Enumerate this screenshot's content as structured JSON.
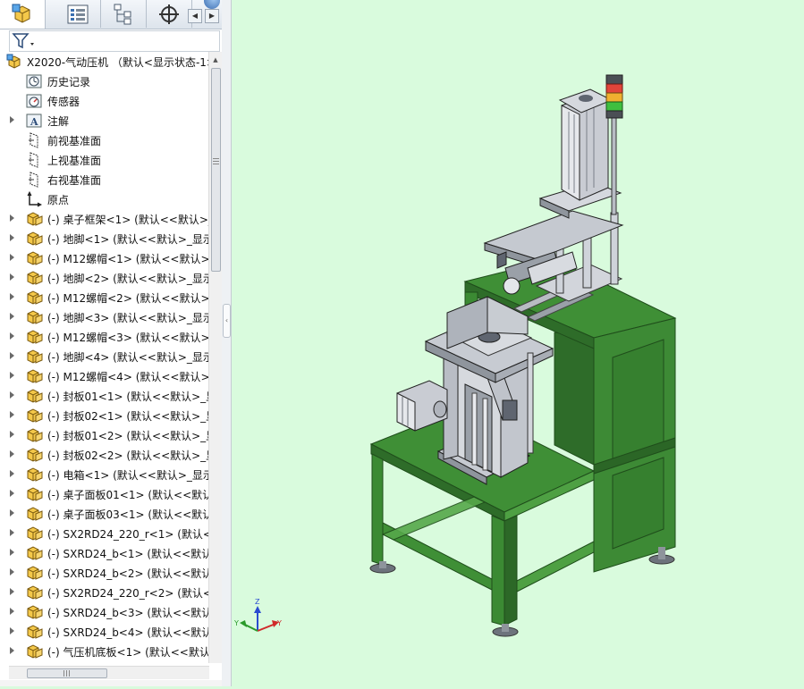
{
  "tabs": [
    {
      "name": "feature-manager",
      "icon": "assembly-icon",
      "active": true
    },
    {
      "name": "property-manager",
      "icon": "property-list-icon"
    },
    {
      "name": "configuration-manager",
      "icon": "configuration-tree-icon"
    },
    {
      "name": "dimxpert-manager",
      "icon": "crosshair-icon"
    }
  ],
  "tree": {
    "root_label": "X2020-气动压机 （默认<显示状态-1>",
    "items": [
      {
        "label": "历史记录",
        "icon": "history-icon",
        "expandable": false
      },
      {
        "label": "传感器",
        "icon": "sensor-icon",
        "expandable": false
      },
      {
        "label": "注解",
        "icon": "annotation-icon",
        "expandable": true
      },
      {
        "label": "前视基准面",
        "icon": "plane-icon",
        "expandable": false
      },
      {
        "label": "上视基准面",
        "icon": "plane-icon",
        "expandable": false
      },
      {
        "label": "右视基准面",
        "icon": "plane-icon",
        "expandable": false
      },
      {
        "label": "原点",
        "icon": "origin-icon",
        "expandable": false
      },
      {
        "label": "(-) 桌子框架<1> (默认<<默认>_",
        "icon": "part-icon",
        "expandable": true
      },
      {
        "label": "(-) 地脚<1> (默认<<默认>_显示",
        "icon": "part-icon",
        "expandable": true
      },
      {
        "label": "(-) M12螺帽<1> (默认<<默认>_",
        "icon": "part-icon",
        "expandable": true
      },
      {
        "label": "(-) 地脚<2> (默认<<默认>_显示",
        "icon": "part-icon",
        "expandable": true
      },
      {
        "label": "(-) M12螺帽<2> (默认<<默认>_",
        "icon": "part-icon",
        "expandable": true
      },
      {
        "label": "(-) 地脚<3> (默认<<默认>_显示",
        "icon": "part-icon",
        "expandable": true
      },
      {
        "label": "(-) M12螺帽<3> (默认<<默认>_",
        "icon": "part-icon",
        "expandable": true
      },
      {
        "label": "(-) 地脚<4> (默认<<默认>_显示",
        "icon": "part-icon",
        "expandable": true
      },
      {
        "label": "(-) M12螺帽<4> (默认<<默认>_",
        "icon": "part-icon",
        "expandable": true
      },
      {
        "label": "(-) 封板01<1> (默认<<默认>_显",
        "icon": "part-icon",
        "expandable": true
      },
      {
        "label": "(-) 封板02<1> (默认<<默认>_显",
        "icon": "part-icon",
        "expandable": true
      },
      {
        "label": "(-) 封板01<2> (默认<<默认>_显",
        "icon": "part-icon",
        "expandable": true
      },
      {
        "label": "(-) 封板02<2> (默认<<默认>_显",
        "icon": "part-icon",
        "expandable": true
      },
      {
        "label": "(-) 电箱<1> (默认<<默认>_显示",
        "icon": "part-icon",
        "expandable": true
      },
      {
        "label": "(-) 桌子面板01<1> (默认<<默认",
        "icon": "part-icon",
        "expandable": true
      },
      {
        "label": "(-) 桌子面板03<1> (默认<<默认",
        "icon": "part-icon",
        "expandable": true
      },
      {
        "label": "(-) SX2RD24_220_r<1> (默认<<",
        "icon": "part-icon",
        "expandable": true
      },
      {
        "label": "(-) SXRD24_b<1> (默认<<默认:",
        "icon": "part-icon",
        "expandable": true
      },
      {
        "label": "(-) SXRD24_b<2> (默认<<默认:",
        "icon": "part-icon",
        "expandable": true
      },
      {
        "label": "(-) SX2RD24_220_r<2> (默认<<",
        "icon": "part-icon",
        "expandable": true
      },
      {
        "label": "(-) SXRD24_b<3> (默认<<默认:",
        "icon": "part-icon",
        "expandable": true
      },
      {
        "label": "(-) SXRD24_b<4> (默认<<默认:",
        "icon": "part-icon",
        "expandable": true
      },
      {
        "label": "(-) 气压机底板<1> (默认<<默认",
        "icon": "part-icon",
        "expandable": true
      }
    ]
  },
  "triad": {
    "x_label": "Y",
    "y_label": "Z",
    "z_label": "Y"
  },
  "colors": {
    "viewport_bg": "#d9fbdd",
    "frame_green": "#3d8a35",
    "frame_green_dark": "#2b6626",
    "frame_green_light": "#5aa84e",
    "steel": "#c9ccd3",
    "steel_dark": "#5f6570",
    "part_yellow": "#f2c34a"
  }
}
